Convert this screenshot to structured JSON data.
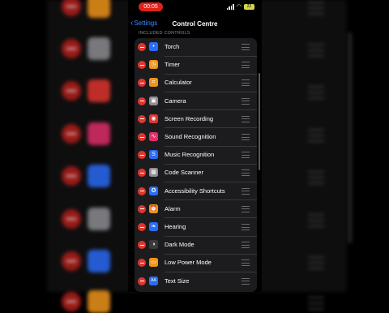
{
  "status_bar": {
    "recording_time": "00:05",
    "battery_level": "22"
  },
  "nav": {
    "back_label": "Settings",
    "title": "Control Centre"
  },
  "section_header": "INCLUDED CONTROLS",
  "controls": [
    {
      "label": "Torch",
      "icon": "flashlight-icon",
      "color": "#2c6cf5",
      "glyph": "•"
    },
    {
      "label": "Timer",
      "icon": "timer-icon",
      "color": "#f0941a",
      "glyph": "◷"
    },
    {
      "label": "Calculator",
      "icon": "calculator-icon",
      "color": "#f0941a",
      "glyph": "⌗"
    },
    {
      "label": "Camera",
      "icon": "camera-icon",
      "color": "#8e8e93",
      "glyph": "▣"
    },
    {
      "label": "Screen Recording",
      "icon": "record-icon",
      "color": "#e0362f",
      "glyph": "◉"
    },
    {
      "label": "Sound Recognition",
      "icon": "sound-recognition-icon",
      "color": "#e0306a",
      "glyph": "∿"
    },
    {
      "label": "Music Recognition",
      "icon": "shazam-icon",
      "color": "#2c6cf5",
      "glyph": "S"
    },
    {
      "label": "Code Scanner",
      "icon": "qr-code-icon",
      "color": "#8e8e93",
      "glyph": "▦"
    },
    {
      "label": "Accessibility Shortcuts",
      "icon": "accessibility-icon",
      "color": "#2c6cf5",
      "glyph": "✪"
    },
    {
      "label": "Alarm",
      "icon": "alarm-icon",
      "color": "#f0941a",
      "glyph": "⏰"
    },
    {
      "label": "Hearing",
      "icon": "ear-icon",
      "color": "#2c6cf5",
      "glyph": "❧"
    },
    {
      "label": "Dark Mode",
      "icon": "dark-mode-icon",
      "color": "#3a3a3c",
      "glyph": "◑"
    },
    {
      "label": "Low Power Mode",
      "icon": "battery-icon",
      "color": "#f0941a",
      "glyph": "▭"
    },
    {
      "label": "Text Size",
      "icon": "text-size-icon",
      "color": "#2c6cf5",
      "glyph": "AA"
    }
  ],
  "background_tiles": [
    {
      "icon": "calculator-icon",
      "color": "#f0941a"
    },
    {
      "icon": "camera-icon",
      "color": "#8e8e93"
    },
    {
      "icon": "record-icon",
      "color": "#e0362f"
    },
    {
      "icon": "sound-recognition-icon",
      "color": "#e0306a"
    },
    {
      "icon": "shazam-icon",
      "color": "#2c6cf5"
    },
    {
      "icon": "qr-code-icon",
      "color": "#8e8e93"
    },
    {
      "icon": "accessibility-icon",
      "color": "#2c6cf5"
    },
    {
      "icon": "alarm-icon",
      "color": "#f0941a"
    }
  ]
}
